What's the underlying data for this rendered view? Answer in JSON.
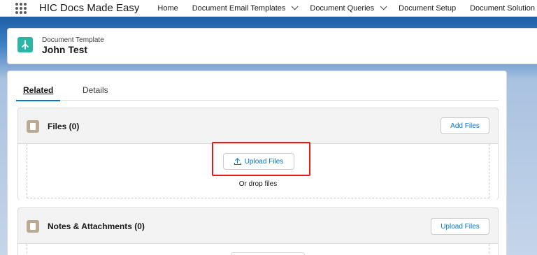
{
  "app": {
    "name": "HIC Docs Made Easy"
  },
  "nav": {
    "items": [
      {
        "label": "Home"
      },
      {
        "label": "Document Email Templates"
      },
      {
        "label": "Document Queries"
      },
      {
        "label": "Document Setup"
      },
      {
        "label": "Document Solution Que"
      }
    ]
  },
  "record": {
    "object_label": "Document Template",
    "name": "John Test"
  },
  "tabs": {
    "related": "Related",
    "details": "Details"
  },
  "files": {
    "title": "Files (0)",
    "add_button": "Add Files",
    "upload_button": "Upload Files",
    "drop_text": "Or drop files"
  },
  "notes": {
    "title": "Notes & Attachments (0)",
    "upload_button": "Upload Files"
  },
  "colors": {
    "accent": "#0176d3",
    "object_icon": "#2bb5a5",
    "list_icon": "#baac93",
    "highlight": "#e41b1b"
  },
  "icons": {
    "app_launcher": "waffle-icon",
    "object": "document-template-icon",
    "files": "file-icon",
    "notes": "note-icon",
    "upload": "upload-icon"
  }
}
